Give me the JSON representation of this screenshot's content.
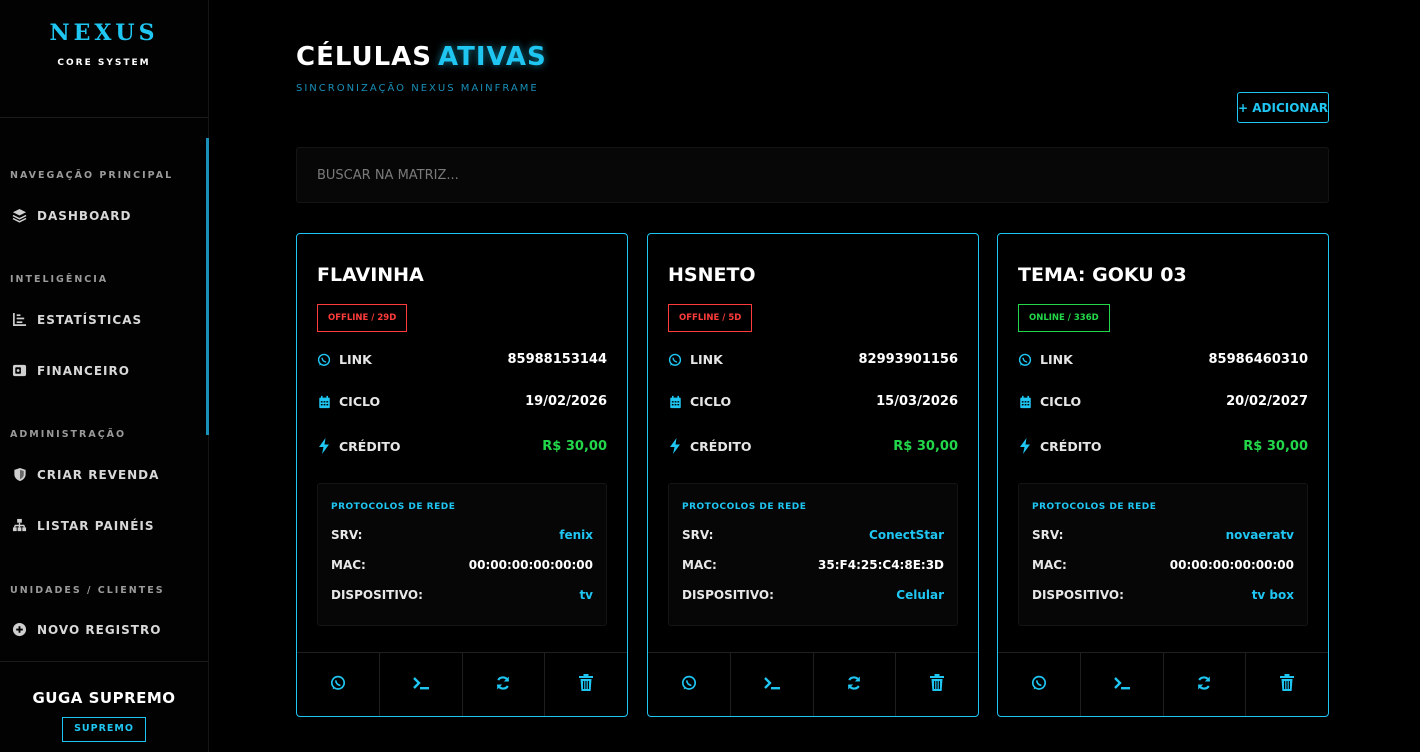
{
  "brand": {
    "title": "NEXUS",
    "subtitle": "CORE SYSTEM"
  },
  "sidebar": {
    "sections": [
      {
        "label": "NAVEGAÇÃO PRINCIPAL"
      },
      {
        "label": "INTELIGÊNCIA"
      },
      {
        "label": "ADMINISTRAÇÃO"
      },
      {
        "label": "UNIDADES / CLIENTES"
      }
    ],
    "items": [
      {
        "label": "DASHBOARD",
        "icon": "layers-icon"
      },
      {
        "label": "ESTATÍSTICAS",
        "icon": "chart-icon"
      },
      {
        "label": "FINANCEIRO",
        "icon": "wallet-icon"
      },
      {
        "label": "CRIAR REVENDA",
        "icon": "shield-icon"
      },
      {
        "label": "LISTAR PAINÉIS",
        "icon": "sitemap-icon"
      },
      {
        "label": "NOVO REGISTRO",
        "icon": "plus-circle-icon"
      }
    ],
    "user": {
      "name": "GUGA SUPREMO",
      "badge": "SUPREMO"
    }
  },
  "header": {
    "title": "CÉLULAS",
    "title_accent": "ATIVAS",
    "subtitle": "SINCRONIZAÇÃO NEXUS MAINFRAME",
    "add_label": "+ ADICIONAR"
  },
  "search": {
    "placeholder": "BUSCAR NA MATRIZ..."
  },
  "labels": {
    "link": "LINK",
    "ciclo": "CICLO",
    "credito": "CRÉDITO",
    "protocols": "PROTOCOLOS DE REDE",
    "srv": "SRV:",
    "mac": "MAC:",
    "device": "DISPOSITIVO:"
  },
  "cards": [
    {
      "name": "FLAVINHA",
      "status": "OFFLINE / 29D",
      "status_kind": "offline",
      "link": "85988153144",
      "ciclo": "19/02/2026",
      "credito": "R$ 30,00",
      "srv": "fenix",
      "mac": "00:00:00:00:00:00",
      "device": "tv"
    },
    {
      "name": "HSNETO",
      "status": "OFFLINE / 5D",
      "status_kind": "offline",
      "link": "82993901156",
      "ciclo": "15/03/2026",
      "credito": "R$ 30,00",
      "srv": "ConectStar",
      "mac": "35:F4:25:C4:8E:3D",
      "device": "Celular"
    },
    {
      "name": "TEMA: GOKU 03",
      "status": "ONLINE / 336D",
      "status_kind": "online",
      "link": "85986460310",
      "ciclo": "20/02/2027",
      "credito": "R$ 30,00",
      "srv": "novaeratv",
      "mac": "00:00:00:00:00:00",
      "device": "tv box"
    }
  ],
  "colors": {
    "accent": "#1fc6f2",
    "offline": "#ff3b3b",
    "online": "#22d84a"
  }
}
